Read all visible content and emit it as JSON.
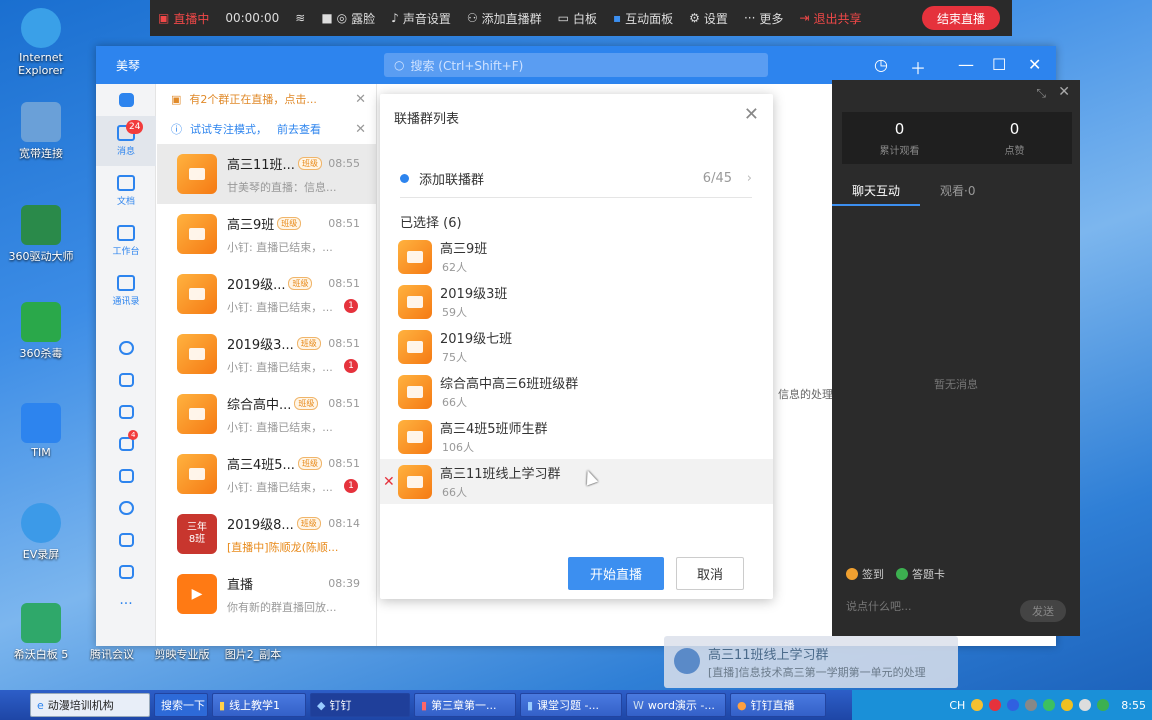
{
  "desktop": {
    "icons": [
      {
        "label": "Internet\nExplorer",
        "color": "#3aa0e8"
      },
      {
        "label": "宽带连接",
        "color": "#6aa0d8"
      },
      {
        "label": "360驱动大师",
        "color": "#2a8a4a"
      },
      {
        "label": "360杀毒",
        "color": "#2aa84a"
      },
      {
        "label": "TIM",
        "color": "#2d84ee"
      },
      {
        "label": "EV录屏",
        "color": "#3c9ae8"
      },
      {
        "label": "希沃白板 5",
        "color": "#2fa86a"
      }
    ],
    "bottom_labels": [
      "腾讯会议",
      "剪映专业版",
      "图片2_副本"
    ]
  },
  "live_toolbar": {
    "status": "直播中",
    "timer": "00:00:00",
    "items": [
      "露脸",
      "声音设置",
      "添加直播群",
      "白板",
      "互动面板",
      "设置",
      "更多"
    ],
    "exit_share": "退出共享",
    "end_live": "结束直播"
  },
  "window": {
    "app_name": "美琴",
    "search_placeholder": "搜索 (Ctrl+Shift+F)"
  },
  "rail": {
    "items": [
      {
        "label": "消息",
        "badge": "24"
      },
      {
        "label": "文档"
      },
      {
        "label": "工作台"
      },
      {
        "label": "通讯录"
      }
    ],
    "small_badge": "4"
  },
  "notices": [
    {
      "text": "有2个群正在直播，点击..."
    },
    {
      "text": "试试专注模式，",
      "link": "前去查看"
    }
  ],
  "chats": [
    {
      "name": "高三11班...",
      "tag": "班级",
      "time": "08:55",
      "msg": "甘美琴的直播：信息...",
      "badge": ""
    },
    {
      "name": "高三9班",
      "tag": "班级",
      "time": "08:51",
      "msg": "小钉: 直播已结束，...",
      "badge": ""
    },
    {
      "name": "2019级...",
      "tag": "班级",
      "time": "08:51",
      "msg": "小钉: 直播已结束，...",
      "badge": "1"
    },
    {
      "name": "2019级3...",
      "tag": "班级",
      "time": "08:51",
      "msg": "小钉: 直播已结束，...",
      "badge": "1"
    },
    {
      "name": "综合高中...",
      "tag": "班级",
      "time": "08:51",
      "msg": "小钉: 直播已结束，...",
      "badge": ""
    },
    {
      "name": "高三4班5...",
      "tag": "班级",
      "time": "08:51",
      "msg": "小钉: 直播已结束，...",
      "badge": "1"
    },
    {
      "name": "2019级8...",
      "tag": "班级",
      "time": "08:14",
      "msg": "[直播中]陈顺龙(陈顺...",
      "badge": ""
    },
    {
      "name": "直播",
      "tag": "",
      "time": "08:39",
      "msg": "你有新的群直播回放...",
      "badge": ""
    }
  ],
  "chat_avatar_red": {
    "line1": "三年",
    "line2": "8班"
  },
  "modal": {
    "title": "联播群列表",
    "add_label": "添加联播群",
    "add_count": "6/45",
    "selected_title": "已选择 (6)",
    "groups": [
      {
        "name": "高三9班",
        "count": "62人"
      },
      {
        "name": "2019级3班",
        "count": "59人"
      },
      {
        "name": "2019级七班",
        "count": "75人"
      },
      {
        "name": "综合高中高三6班班级群",
        "count": "66人"
      },
      {
        "name": "高三4班5班师生群",
        "count": "106人"
      },
      {
        "name": "高三11班线上学习群",
        "count": "66人"
      }
    ],
    "start": "开始直播",
    "cancel": "取消"
  },
  "behind_text": "信息的处理",
  "live_panel": {
    "views": "0",
    "views_label": "累计观看",
    "likes": "0",
    "likes_label": "点赞",
    "tab_chat": "聊天互动",
    "tab_watch": "观看·0",
    "empty": "暂无消息",
    "checkin": "签到",
    "answer": "答题卡",
    "input_placeholder": "说点什么吧...",
    "send": "发送"
  },
  "toast": {
    "title": "高三11班线上学习群",
    "text": "[直播]信息技术高三第一学期第一单元的处理"
  },
  "taskbar": {
    "start": "动漫培训机构",
    "search": "搜索一下",
    "tasks": [
      "线上教学1",
      "钉钉",
      "第三章第一...",
      "课堂习题 -...",
      "word演示 -...",
      "钉钉直播"
    ],
    "ime": "CH",
    "clock": "8:55"
  }
}
